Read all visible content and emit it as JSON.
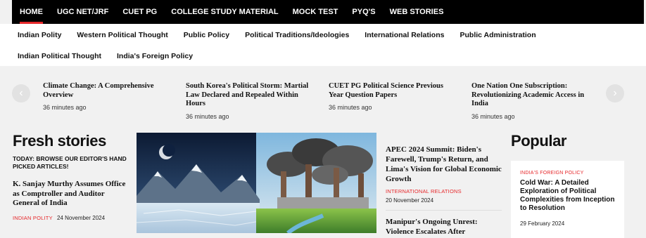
{
  "topnav": [
    "HOME",
    "UGC NET/JRF",
    "CUET PG",
    "COLLEGE STUDY MATERIAL",
    "MOCK TEST",
    "PYQ'S",
    "WEB STORIES"
  ],
  "subnav_row1": [
    "Indian Polity",
    "Western Political Thought",
    "Public Policy",
    "Political Traditions/Ideologies",
    "International Relations",
    "Public Administration"
  ],
  "subnav_row2": [
    "Indian Political Thought",
    "India's Foreign Policy"
  ],
  "ticker": [
    {
      "title": "Climate Change: A Comprehensive Overview",
      "time": "36 minutes ago"
    },
    {
      "title": "South Korea's Political Storm: Martial Law Declared and Repealed Within Hours",
      "time": "36 minutes ago"
    },
    {
      "title": "CUET PG Political Science Previous Year Question Papers",
      "time": "36 minutes ago"
    },
    {
      "title": "One Nation One Subscription: Revolutionizing Academic Access in India",
      "time": "36 minutes ago"
    }
  ],
  "fresh": {
    "heading": "Fresh stories",
    "subheading": "TODAY: BROWSE OUR EDITOR'S HAND PICKED ARTICLES!",
    "article": {
      "title": "K. Sanjay Murthy Assumes Office as Comptroller and Auditor General of India",
      "category": "INDIAN POLITY",
      "date": "24 November 2024"
    }
  },
  "mid": [
    {
      "title": "APEC 2024 Summit: Biden's Farewell, Trump's Return, and Lima's Vision for Global Economic Growth",
      "category": "INTERNATIONAL RELATIONS",
      "date": "20 November 2024"
    },
    {
      "title": "Manipur's Ongoing Unrest: Violence Escalates After"
    }
  ],
  "popular": {
    "heading": "Popular",
    "article": {
      "category": "INDIA'S FOREIGN POLICY",
      "title": "Cold War: A Detailed Exploration of Political Complexities from Inception to Resolution",
      "date": "29 February 2024"
    }
  },
  "colors": {
    "accent": "#e6282b",
    "topbar": "#000000"
  },
  "icons": {
    "prev": "chevron-left-icon",
    "next": "chevron-right-icon"
  }
}
